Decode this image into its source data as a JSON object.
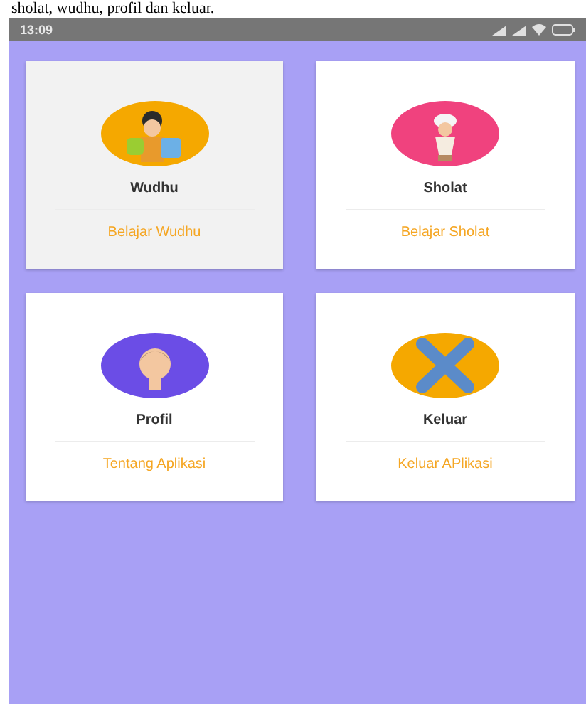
{
  "caption": "sholat, wudhu, profil dan keluar.",
  "status_bar": {
    "time": "13:09"
  },
  "menu_cards": [
    {
      "title": "Wudhu",
      "action": "Belajar Wudhu",
      "selected": true,
      "color": "#f5a800"
    },
    {
      "title": "Sholat",
      "action": "Belajar Sholat",
      "selected": false,
      "color": "#f0427e"
    },
    {
      "title": "Profil",
      "action": "Tentang Aplikasi",
      "selected": false,
      "color": "#6b4de6"
    },
    {
      "title": "Keluar",
      "action": "Keluar APlikasi",
      "selected": false,
      "color": "#f5a800"
    }
  ]
}
